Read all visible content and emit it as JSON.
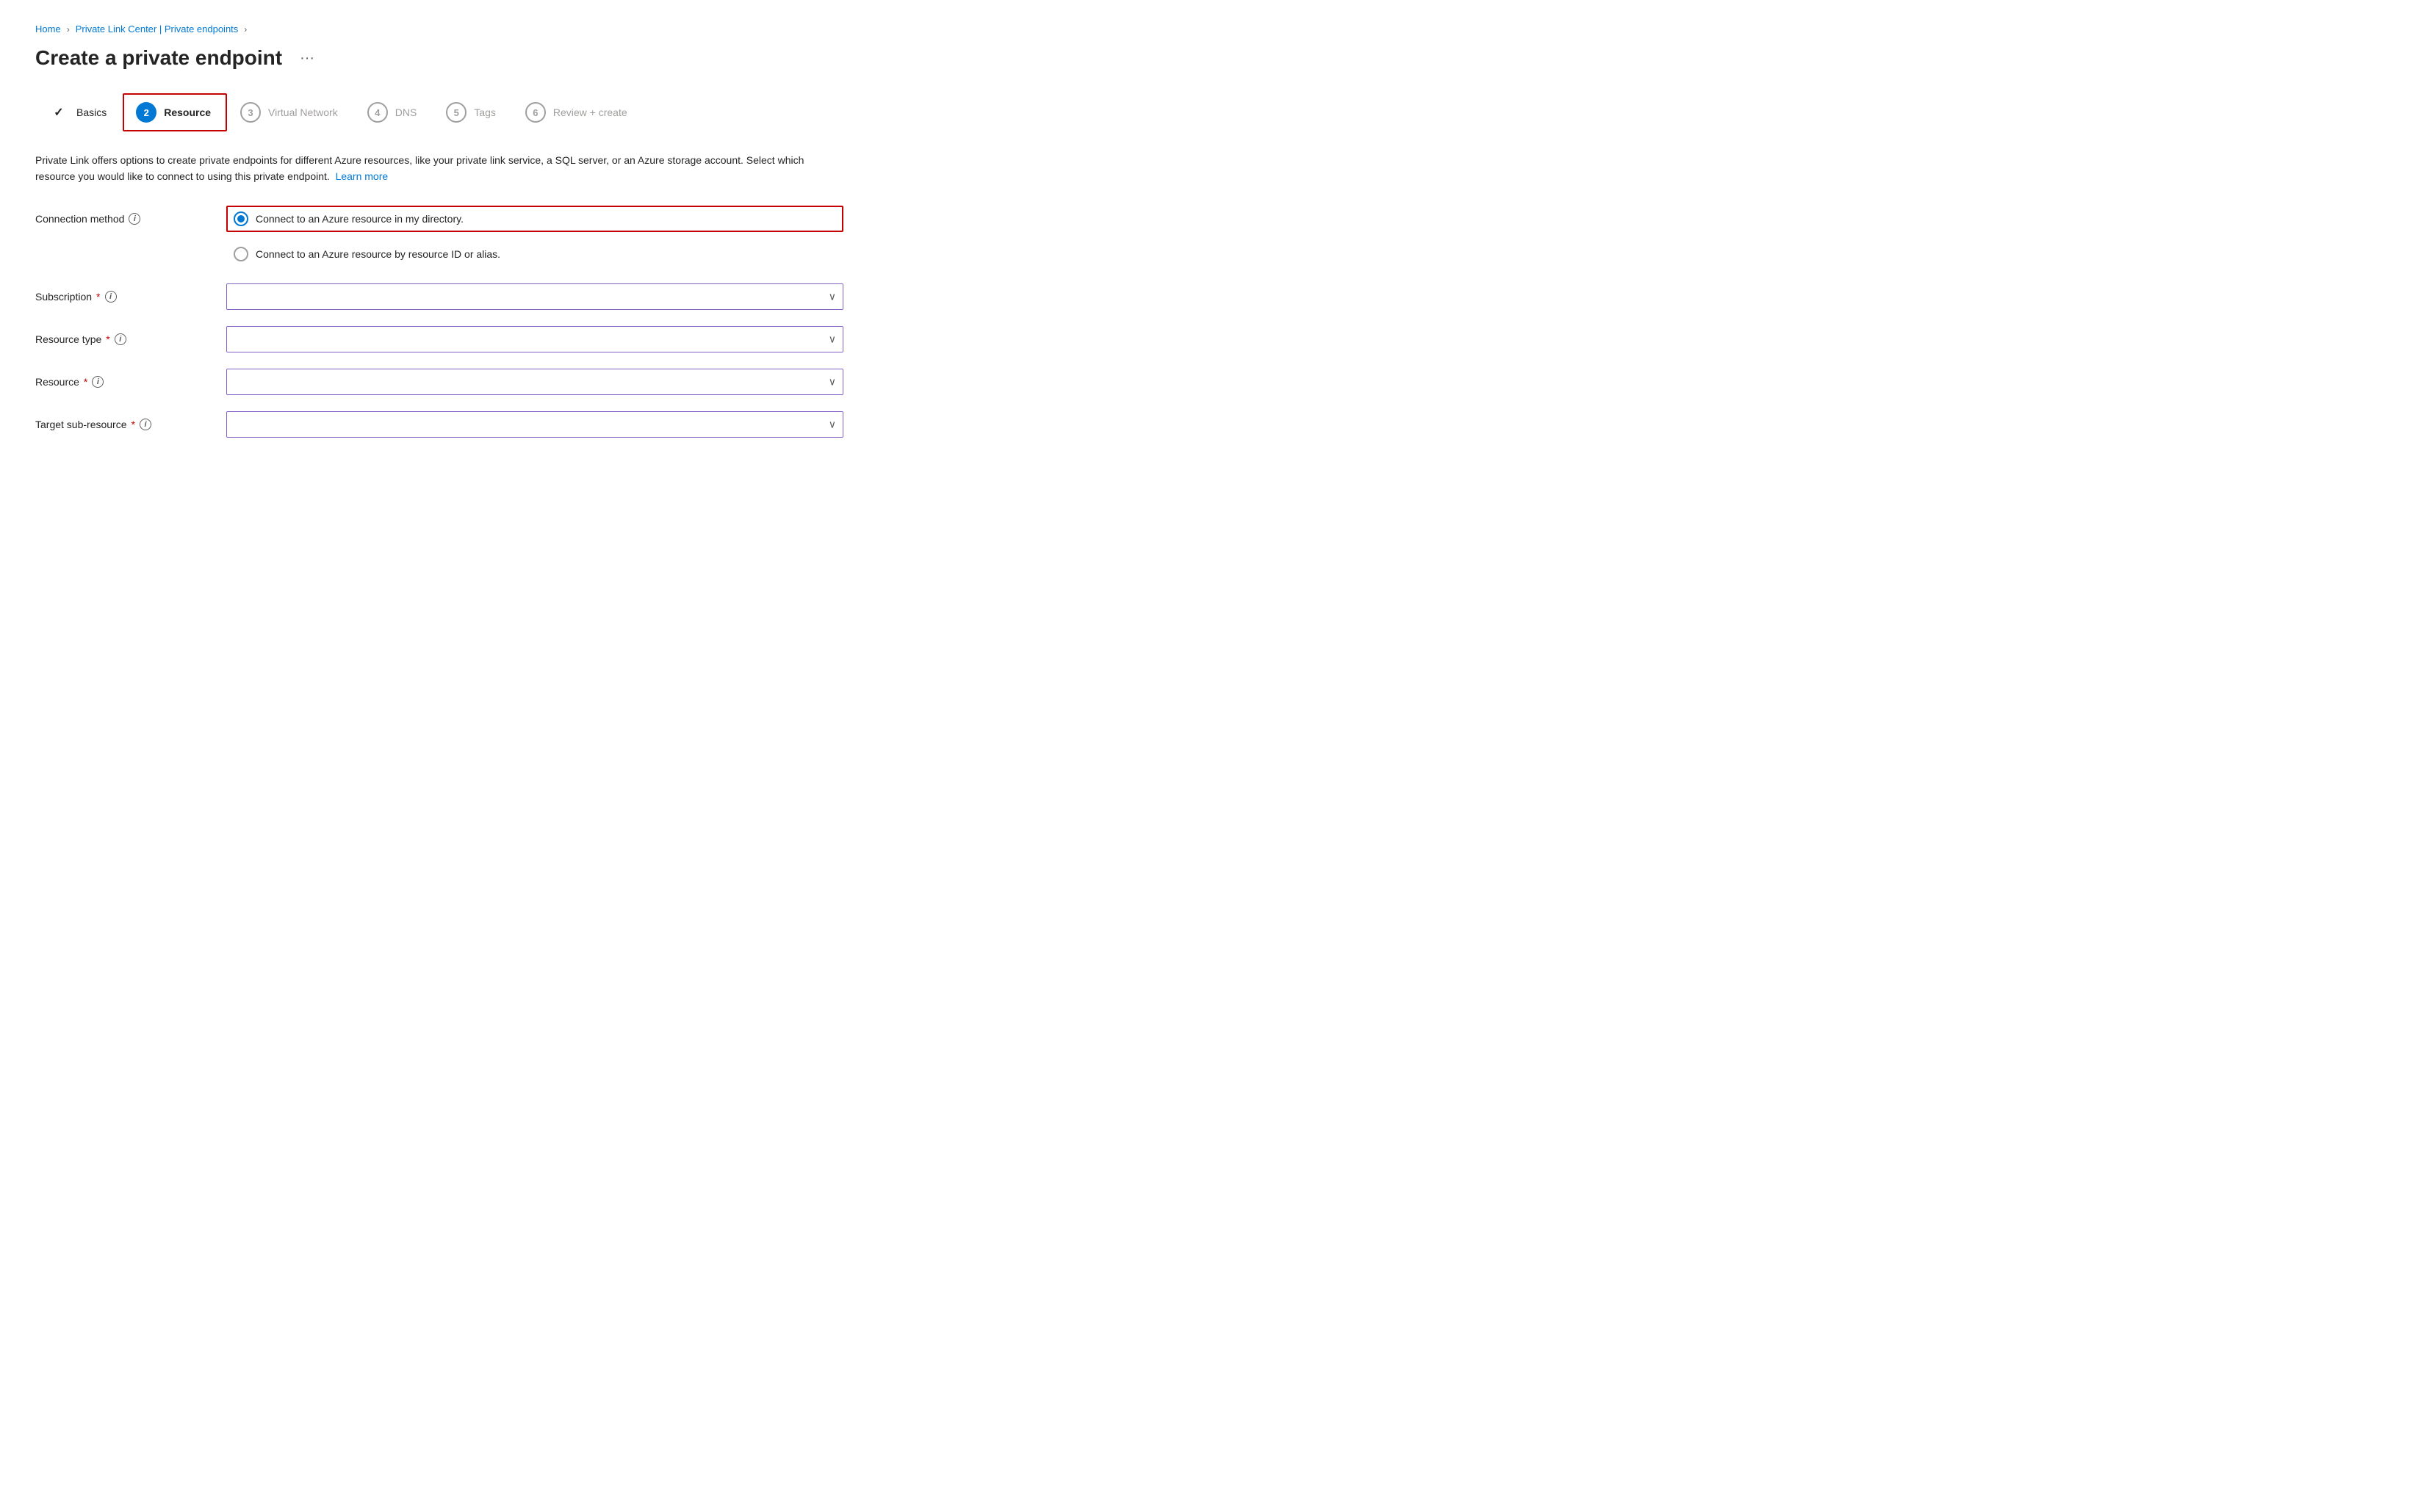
{
  "breadcrumb": {
    "items": [
      {
        "label": "Home",
        "href": "#"
      },
      {
        "label": "Private Link Center | Private endpoints",
        "href": "#"
      }
    ]
  },
  "page": {
    "title": "Create a private endpoint",
    "ellipsis_label": "···"
  },
  "wizard": {
    "steps": [
      {
        "id": "basics",
        "number": "✓",
        "label": "Basics",
        "state": "completed"
      },
      {
        "id": "resource",
        "number": "2",
        "label": "Resource",
        "state": "active"
      },
      {
        "id": "virtual-network",
        "number": "3",
        "label": "Virtual Network",
        "state": "inactive"
      },
      {
        "id": "dns",
        "number": "4",
        "label": "DNS",
        "state": "inactive"
      },
      {
        "id": "tags",
        "number": "5",
        "label": "Tags",
        "state": "inactive"
      },
      {
        "id": "review-create",
        "number": "6",
        "label": "Review + create",
        "state": "inactive"
      }
    ]
  },
  "description": {
    "text": "Private Link offers options to create private endpoints for different Azure resources, like your private link service, a SQL server, or an Azure storage account. Select which resource you would like to connect to using this private endpoint.",
    "learn_more": "Learn more"
  },
  "form": {
    "connection_method": {
      "label": "Connection method",
      "options": [
        {
          "id": "directory",
          "label": "Connect to an Azure resource in my directory.",
          "selected": true
        },
        {
          "id": "resource-id",
          "label": "Connect to an Azure resource by resource ID or alias.",
          "selected": false
        }
      ]
    },
    "subscription": {
      "label": "Subscription",
      "required": true,
      "placeholder": "",
      "options": []
    },
    "resource_type": {
      "label": "Resource type",
      "required": true,
      "placeholder": "",
      "options": []
    },
    "resource": {
      "label": "Resource",
      "required": true,
      "placeholder": "",
      "options": []
    },
    "target_sub_resource": {
      "label": "Target sub-resource",
      "required": true,
      "placeholder": "",
      "options": []
    }
  }
}
